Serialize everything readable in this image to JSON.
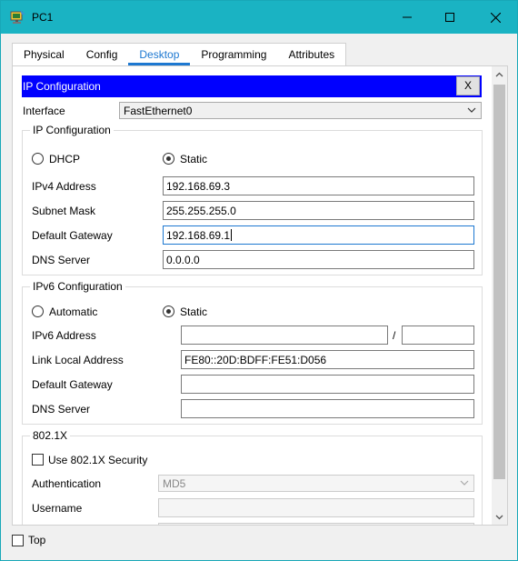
{
  "window": {
    "title": "PC1",
    "controls": {
      "minimize": "minimize",
      "maximize": "maximize",
      "close": "close"
    },
    "accent_color": "#1ab3c3"
  },
  "tabs": [
    {
      "label": "Physical"
    },
    {
      "label": "Config"
    },
    {
      "label": "Desktop",
      "active": true
    },
    {
      "label": "Programming"
    },
    {
      "label": "Attributes"
    }
  ],
  "ip_config": {
    "header_title": "IP Configuration",
    "header_color": "#0000ff",
    "close_label": "X",
    "interface_label": "Interface",
    "interface_value": "FastEthernet0",
    "ipv4": {
      "group_title": "IP Configuration",
      "dhcp_label": "DHCP",
      "static_label": "Static",
      "selected_mode": "Static",
      "ipv4_address_label": "IPv4 Address",
      "ipv4_address_value": "192.168.69.3",
      "subnet_mask_label": "Subnet Mask",
      "subnet_mask_value": "255.255.255.0",
      "default_gateway_label": "Default Gateway",
      "default_gateway_value": "192.168.69.1",
      "dns_server_label": "DNS Server",
      "dns_server_value": "0.0.0.0"
    },
    "ipv6": {
      "group_title": "IPv6 Configuration",
      "automatic_label": "Automatic",
      "static_label": "Static",
      "selected_mode": "Static",
      "ipv6_address_label": "IPv6 Address",
      "ipv6_address_value": "",
      "prefix_separator": "/",
      "prefix_value": "",
      "link_local_label": "Link Local Address",
      "link_local_value": "FE80::20D:BDFF:FE51:D056",
      "default_gateway_label": "Default Gateway",
      "default_gateway_value": "",
      "dns_server_label": "DNS Server",
      "dns_server_value": ""
    },
    "dot1x": {
      "group_title": "802.1X",
      "use_security_label": "Use 802.1X Security",
      "use_security_checked": false,
      "authentication_label": "Authentication",
      "authentication_value": "MD5",
      "username_label": "Username",
      "username_value": ""
    }
  },
  "footer": {
    "top_label": "Top",
    "top_checked": false
  }
}
